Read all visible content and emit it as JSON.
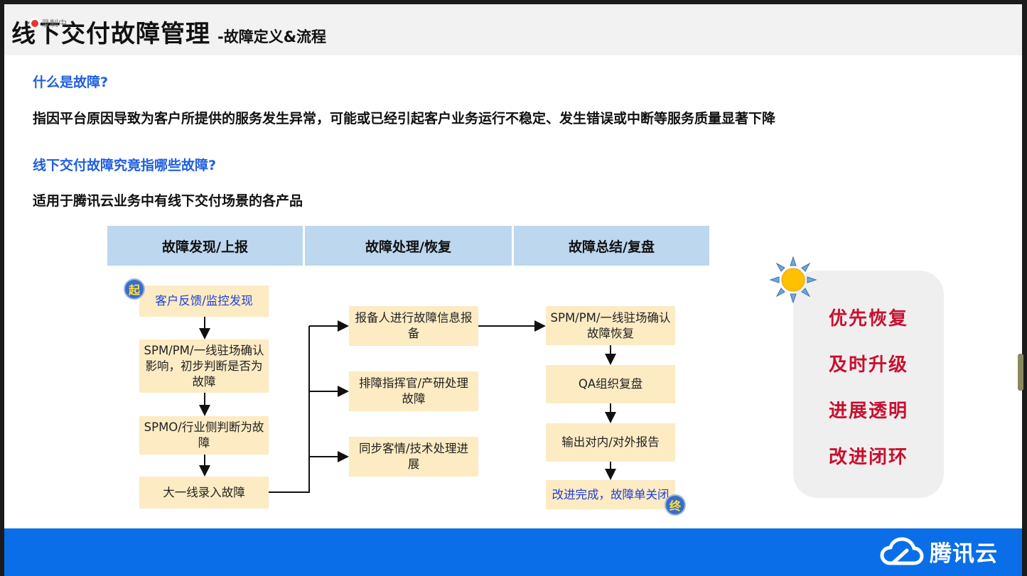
{
  "title": {
    "main": "线下交付故障管理",
    "sub": "-故障定义&流程",
    "recording_label": "录制中"
  },
  "section1": {
    "question": "什么是故障?",
    "answer": "指因平台原因导致为客户所提供的服务发生异常，可能或已经引起客户业务运行不稳定、发生错误或中断等服务质量显著下降"
  },
  "section2": {
    "question": "线下交付故障究竟指哪些故障?",
    "answer": "适用于腾讯云业务中有线下交付场景的各产品"
  },
  "flow": {
    "headers": [
      "故障发现/上报",
      "故障处理/恢复",
      "故障总结/复盘"
    ],
    "start_badge": "起",
    "end_badge": "终",
    "col1": [
      "客户反馈/监控发现",
      "SPM/PM/一线驻场确认影响，初步判断是否为故障",
      "SPMO/行业侧判断为故障",
      "大一线录入故障"
    ],
    "col2": [
      "报备人进行故障信息报备",
      "排障指挥官/产研处理故障",
      "同步客情/技术处理进展"
    ],
    "col3": [
      "SPM/PM/一线驻场确认故障恢复",
      "QA组织复盘",
      "输出对内/对外报告",
      "改进完成，故障单关闭"
    ]
  },
  "principles": [
    "优先恢复",
    "及时升级",
    "进展透明",
    "改进闭环"
  ],
  "footer": {
    "brand": "腾讯云"
  },
  "colors": {
    "accent_blue": "#1f5fe0",
    "header_fill": "#bcd7ee",
    "box_fill": "#fcebc3",
    "principle_red": "#c8102e",
    "footer_blue": "#0a6ee8"
  },
  "icons": [
    "sun-icon",
    "tencent-cloud-logo-icon",
    "recording-dot-icon"
  ]
}
